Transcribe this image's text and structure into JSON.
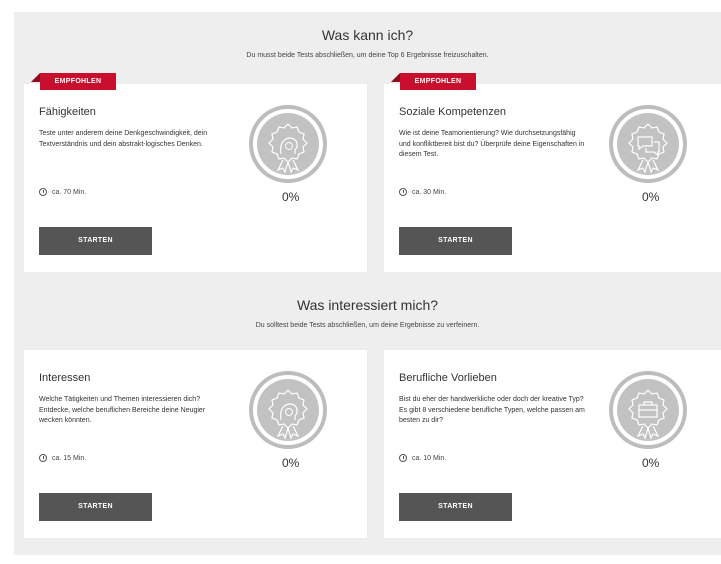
{
  "sections": [
    {
      "title": "Was kann ich?",
      "subtitle": "Du musst beide Tests abschließen, um deine Top 6 Ergebnisse freizuschalten.",
      "cards": [
        {
          "badge": "EMPFOHLEN",
          "title": "Fähigkeiten",
          "description": "Teste unter anderem deine Denkgeschwindigkeit, dein Textverständnis und dein abstrakt-logisches Denken.",
          "duration": "ca. 70 Min.",
          "progress": "0%",
          "button": "STARTEN",
          "icon": "head-brain-icon"
        },
        {
          "badge": "EMPFOHLEN",
          "title": "Soziale Kompetenzen",
          "description": "Wie ist deine Teamorientierung? Wie durchsetzungsfähig und konfliktbereit bist du? Überprüfe deine Eigenschaften in diesem Test.",
          "duration": "ca. 30 Min.",
          "progress": "0%",
          "button": "STARTEN",
          "icon": "speech-bubbles-icon"
        }
      ]
    },
    {
      "title": "Was interessiert mich?",
      "subtitle": "Du solltest beide Tests abschließen, um deine Ergebnisse zu verfeinern.",
      "cards": [
        {
          "title": "Interessen",
          "description": "Welche Tätigkeiten und Themen interessieren dich? Entdecke, welche beruflichen Bereiche deine Neugier wecken könnten.",
          "duration": "ca. 15 Min.",
          "progress": "0%",
          "button": "STARTEN",
          "icon": "head-brain-icon"
        },
        {
          "title": "Berufliche Vorlieben",
          "description": "Bist du eher der handwerkliche oder doch der kreative Typ? Es gibt 8 verschiedene berufliche Typen, welche passen am besten zu dir?",
          "duration": "ca. 10 Min.",
          "progress": "0%",
          "button": "STARTEN",
          "icon": "briefcase-icon"
        }
      ]
    }
  ],
  "colors": {
    "accent": "#c8102e",
    "button": "#555555",
    "ring": "#bdbdbd",
    "background": "#eeeeee"
  }
}
